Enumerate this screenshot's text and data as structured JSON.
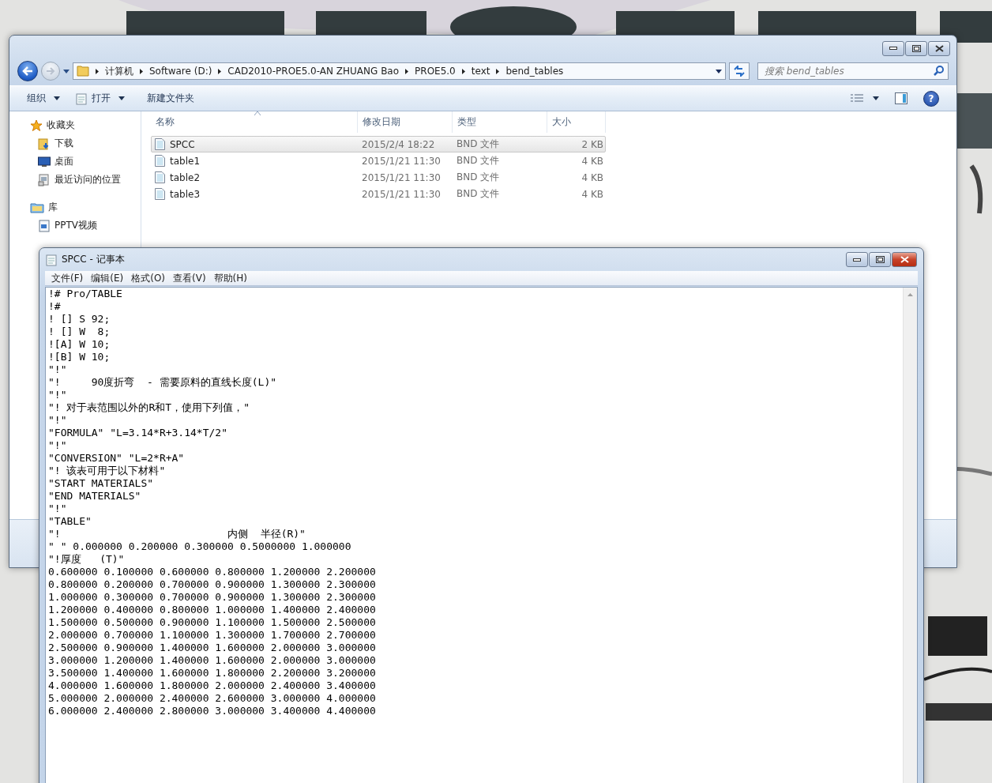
{
  "explorer": {
    "breadcrumbs": [
      "计算机",
      "Software (D:)",
      "CAD2010-PROE5.0-AN ZHUANG Bao",
      "PROE5.0",
      "text",
      "bend_tables"
    ],
    "search": {
      "placeholder": "搜索 bend_tables"
    },
    "help_label": "?",
    "toolbar": [
      {
        "label": "组织",
        "kind": "menu"
      },
      {
        "label": "打开",
        "kind": "menu"
      },
      {
        "label": "新建文件夹",
        "kind": "button"
      }
    ],
    "sidebar": [
      {
        "label": "收藏夹",
        "children": [
          {
            "label": "下载"
          },
          {
            "label": "桌面"
          },
          {
            "label": "最近访问的位置"
          }
        ]
      },
      {
        "label": "库",
        "children": [
          {
            "label": "PPTV视频"
          }
        ]
      }
    ],
    "table": {
      "columns": [
        {
          "label": "名称",
          "sorted": true
        },
        {
          "label": "修改日期",
          "sorted": false
        },
        {
          "label": "类型",
          "sorted": false
        },
        {
          "label": "大小",
          "sorted": false
        }
      ],
      "rows": [
        {
          "cells": [
            "SPCC",
            "2015/2/4 18:22",
            "BND 文件",
            "2 KB"
          ],
          "selected": true
        },
        {
          "cells": [
            "table1",
            "2015/1/21 11:30",
            "BND 文件",
            "4 KB"
          ],
          "selected": false
        },
        {
          "cells": [
            "table2",
            "2015/1/21 11:30",
            "BND 文件",
            "4 KB"
          ],
          "selected": false
        },
        {
          "cells": [
            "table3",
            "2015/1/21 11:30",
            "BND 文件",
            "4 KB"
          ],
          "selected": false
        }
      ]
    }
  },
  "notepad": {
    "title": "SPCC - 记事本",
    "menu": [
      "文件(F)",
      "编辑(E)",
      "格式(O)",
      "查看(V)",
      "帮助(H)"
    ],
    "lines": [
      "!# Pro/TABLE",
      "!#",
      "! [] S 92;",
      "! [] W  8;",
      "![A] W 10;",
      "![B] W 10;",
      "\"!\"",
      "\"!     90度折弯  - 需要原料的直线长度(L)\"",
      "\"!\"",
      "\"! 对于表范围以外的R和T，使用下列值，\"",
      "\"!\"",
      "\"FORMULA\" \"L=3.14*R+3.14*T/2\"",
      "\"!\"",
      "\"CONVERSION\" \"L=2*R+A\"",
      "\"! 该表可用于以下材料\"",
      "\"START MATERIALS\"",
      "\"END MATERIALS\"",
      "\"!\"",
      "\"TABLE\"",
      "\"!                           内侧  半径(R)\"",
      "\" \" 0.000000 0.200000 0.300000 0.5000000 1.000000",
      "\"!厚度   (T)\"",
      "0.600000 0.100000 0.600000 0.800000 1.200000 2.200000",
      "0.800000 0.200000 0.700000 0.900000 1.300000 2.300000",
      "1.000000 0.300000 0.700000 0.900000 1.300000 2.300000",
      "1.200000 0.400000 0.800000 1.000000 1.400000 2.400000",
      "1.500000 0.500000 0.900000 1.100000 1.500000 2.500000",
      "2.000000 0.700000 1.100000 1.300000 1.700000 2.700000",
      "2.500000 0.900000 1.400000 1.600000 2.000000 3.000000",
      "3.000000 1.200000 1.400000 1.600000 2.000000 3.000000",
      "3.500000 1.400000 1.600000 1.800000 2.200000 3.200000",
      "4.000000 1.600000 1.800000 2.000000 2.400000 3.400000",
      "5.000000 2.000000 2.400000 2.600000 3.000000 4.000000",
      "6.000000 2.400000 2.800000 3.000000 3.400000 4.400000"
    ]
  }
}
